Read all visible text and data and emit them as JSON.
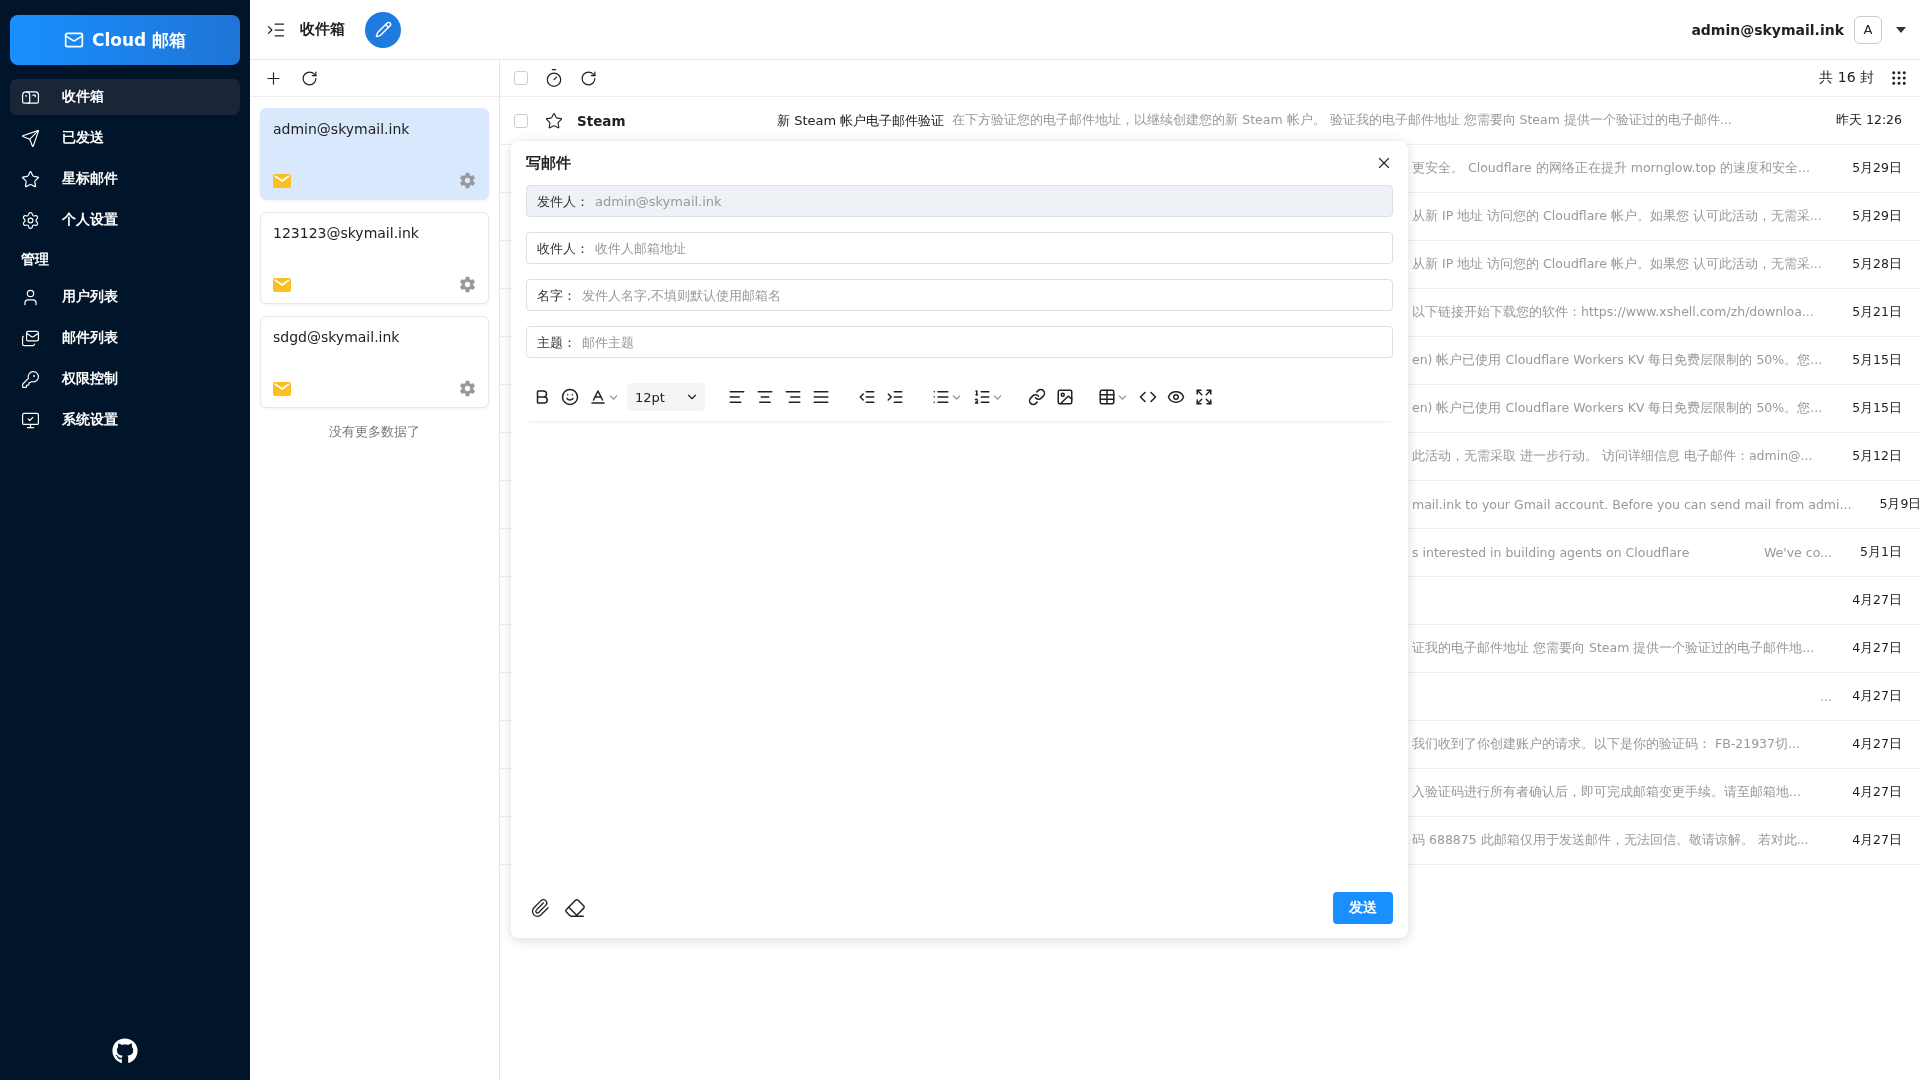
{
  "sidebar": {
    "logo": "Cloud 邮箱",
    "nav": [
      {
        "label": "收件箱",
        "selected": true
      },
      {
        "label": "已发送",
        "selected": false
      },
      {
        "label": "星标邮件",
        "selected": false
      },
      {
        "label": "个人设置",
        "selected": false
      }
    ],
    "section_title": "管理",
    "admin_nav": [
      {
        "label": "用户列表",
        "selected": false
      },
      {
        "label": "邮件列表",
        "selected": false
      },
      {
        "label": "权限控制",
        "selected": false
      },
      {
        "label": "系统设置",
        "selected": false
      }
    ]
  },
  "topbar": {
    "title": "收件箱",
    "user": "admin@skymail.ink",
    "avatar": "A"
  },
  "accounts": [
    {
      "email": "admin@skymail.ink",
      "selected": true
    },
    {
      "email": "123123@skymail.ink",
      "selected": false
    },
    {
      "email": "sdgd@skymail.ink",
      "selected": false
    }
  ],
  "accounts_footer": "没有更多数据了",
  "mail_toolbar": {
    "select_all_checked": false,
    "count": "共 16 封"
  },
  "mails": [
    {
      "kind": "full",
      "checked": false,
      "starred": false,
      "sender": "Steam",
      "subject": "新 Steam 帐户电子邮件验证",
      "preview": "在下方验证您的电子邮件地址，以继续创建您的新 Steam 帐户。 验证我的电子邮件地址 您需要向 Steam 提供一个验证过的电子邮件...",
      "date": "昨天 12:26"
    },
    {
      "kind": "partial",
      "preview": "更安全。 Cloudflare 的网络正在提升 mornglow.top 的速度和安全...",
      "date": "5月29日"
    },
    {
      "kind": "partial",
      "preview": "从新 IP 地址 访问您的 Cloudflare 帐户。如果您 认可此活动，无需采...",
      "date": "5月29日"
    },
    {
      "kind": "partial",
      "preview": "从新 IP 地址 访问您的 Cloudflare 帐户。如果您 认可此活动，无需采...",
      "date": "5月28日"
    },
    {
      "kind": "partial",
      "preview": "以下链接开始下载您的软件：https://www.xshell.com/zh/downloa...",
      "date": "5月21日"
    },
    {
      "kind": "partial",
      "preview": "en) 帐户已使用 Cloudflare Workers KV 每日免费层限制的 50%。您...",
      "date": "5月15日"
    },
    {
      "kind": "partial",
      "preview": "en) 帐户已使用 Cloudflare Workers KV 每日免费层限制的 50%。您...",
      "date": "5月15日"
    },
    {
      "kind": "partial",
      "preview": "此活动，无需采取 进一步行动。 访问详细信息 电子邮件：admin@...",
      "date": "5月12日"
    },
    {
      "kind": "partial",
      "preview": "mail.ink to your Gmail account. Before you can send mail from admi...",
      "date": "5月9日"
    },
    {
      "kind": "partial",
      "preview": "s interested in building agents on Cloudflare",
      "preview_end": "We've co...",
      "date": "5月1日"
    },
    {
      "kind": "partial",
      "date": "4月27日"
    },
    {
      "kind": "partial",
      "preview": "证我的电子邮件地址 您需要向 Steam 提供一个验证过的电子邮件地...",
      "date": "4月27日"
    },
    {
      "kind": "partial",
      "preview_end": "...",
      "date": "4月27日"
    },
    {
      "kind": "partial",
      "preview": "我们收到了你创建账户的请求。以下是你的验证码： FB-21937切...",
      "date": "4月27日"
    },
    {
      "kind": "partial",
      "preview": "入验证码进行所有者确认后，即可完成邮箱变更手续。请至邮箱地...",
      "date": "4月27日"
    },
    {
      "kind": "partial",
      "preview": "码 688875 此邮箱仅用于发送邮件，无法回信。敬请谅解。 若对此...",
      "date": "4月27日"
    }
  ],
  "compose": {
    "title": "写邮件",
    "fields": [
      {
        "label": "发件人：",
        "value": "admin@skymail.ink",
        "disabled": true
      },
      {
        "label": "收件人：",
        "placeholder": "收件人邮箱地址",
        "disabled": false
      },
      {
        "label": "名字：",
        "placeholder": "发件人名字,不填则默认使用邮箱名",
        "disabled": false
      },
      {
        "label": "主题：",
        "placeholder": "邮件主题",
        "disabled": false
      }
    ],
    "font_size": "12pt",
    "send": "发送"
  }
}
